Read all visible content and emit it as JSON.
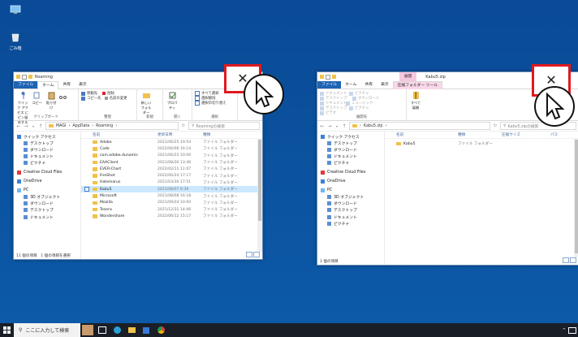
{
  "desktop": {
    "icons": [
      {
        "label": "",
        "icon": "pc-icon"
      },
      {
        "label": "ごみ箱",
        "icon": "recycle-bin-icon"
      }
    ]
  },
  "left_window": {
    "title": "Roaming",
    "tabs": [
      "ファイル",
      "ホーム",
      "共有",
      "表示"
    ],
    "ribbon": {
      "pin_label": "クイック アクセス にピン留めする",
      "copy_label": "コピー",
      "paste_label": "貼り付け",
      "clipboard_group": "クリップボード",
      "move_to": "移動先",
      "delete": "削除",
      "copy_to": "コピー先",
      "rename": "名前の変更",
      "organize_group": "整理",
      "new_folder": "新しい フォルダー",
      "new_group": "新規",
      "properties": "プロパティ",
      "open_group": "開く",
      "select_all": "すべて選択",
      "select_none": "選択解除",
      "invert_selection": "選択の切り替え",
      "select_group": "選択"
    },
    "address": [
      "MAGI",
      "AppData",
      "Roaming"
    ],
    "search_placeholder": "Roamingの検索",
    "columns": {
      "name": "名前",
      "date": "更新日時",
      "type": "種類"
    },
    "files": [
      {
        "name": "Adobe",
        "date": "2021/06/25 19:54",
        "type": "ファイル フォルダー",
        "selected": false
      },
      {
        "name": "Code",
        "date": "2022/06/06 16:14",
        "type": "ファイル フォルダー",
        "selected": false
      },
      {
        "name": "com.adobe.dunamis",
        "date": "2021/06/25 10:00",
        "type": "ファイル フォルダー",
        "selected": false
      },
      {
        "name": "EAAClient",
        "date": "2021/08/30 13:46",
        "type": "ファイル フォルダー",
        "selected": false
      },
      {
        "name": "EVER-Chart",
        "date": "2022/02/11 11:07",
        "type": "ファイル フォルダー",
        "selected": false
      },
      {
        "name": "FireShot",
        "date": "2022/06/24 17:17",
        "type": "ファイル フォルダー",
        "selected": false
      },
      {
        "name": "Hatemarus",
        "date": "2021/03/30 17:51",
        "type": "ファイル フォルダー",
        "selected": false
      },
      {
        "name": "Kabu5",
        "date": "2021/08/07 9:39",
        "type": "ファイル フォルダー",
        "selected": true
      },
      {
        "name": "Microsoft",
        "date": "2021/08/08 16:18",
        "type": "ファイル フォルダー",
        "selected": false
      },
      {
        "name": "Mozilla",
        "date": "2021/09/24 10:00",
        "type": "ファイル フォルダー",
        "selected": false
      },
      {
        "name": "Tesera",
        "date": "2021/12/31 14:06",
        "type": "ファイル フォルダー",
        "selected": false
      },
      {
        "name": "Wondershare",
        "date": "2022/06/12 15:17",
        "type": "ファイル フォルダー",
        "selected": false
      }
    ],
    "nav": [
      "クイック アクセス",
      "デスクトップ",
      "ダウンロード",
      "ドキュメント",
      "ピクチャ",
      "Creative Cloud Files",
      "OneDrive",
      "PC",
      "3D オブジェクト",
      "ダウンロード",
      "デスクトップ",
      "ドキュメント"
    ],
    "status": "11 個の項目　1 個の項目を選択"
  },
  "right_window": {
    "title": "Kabu5.zip",
    "context_head": "展開",
    "tabs": [
      "ファイル",
      "ホーム",
      "共有",
      "表示",
      "圧縮フォルダー ツール"
    ],
    "ribbon": {
      "items": [
        "ドキュメント",
        "ピクチャ",
        "デスクトップ",
        "ダウンロード",
        "ドキュメント",
        "ミュージック",
        "デスクトップ",
        "ピクチャ",
        "ビデオ"
      ],
      "extract_all": "すべて 展開",
      "group_label": "展開先"
    },
    "address": [
      "Kabu5.zip"
    ],
    "search_placeholder": "Kabu5.zipの検索",
    "columns": {
      "name": "名前",
      "type": "種類",
      "compressed": "圧縮サイズ",
      "password": "パス"
    },
    "files": [
      {
        "name": "Kabu5",
        "type": "ファイル フォルダー"
      }
    ],
    "nav": [
      "クイック アクセス",
      "デスクトップ",
      "ダウンロード",
      "ドキュメント",
      "ピクチャ",
      "Creative Cloud Files",
      "OneDrive",
      "PC",
      "3D オブジェクト",
      "ダウンロード",
      "デスクトップ",
      "ドキュメント",
      "ピクチャ"
    ],
    "status": "1 個の項目"
  },
  "close_glyph": "✕",
  "taskbar": {
    "search_placeholder": "ここに入力して検索",
    "apps": [
      "person-photo-icon",
      "task-view-icon",
      "edge-icon",
      "explorer-icon",
      "store-icon",
      "chrome-icon"
    ]
  },
  "colors": {
    "highlight": "#e0191f",
    "selection": "#cce8ff",
    "desktop": "#0b4f9c"
  }
}
